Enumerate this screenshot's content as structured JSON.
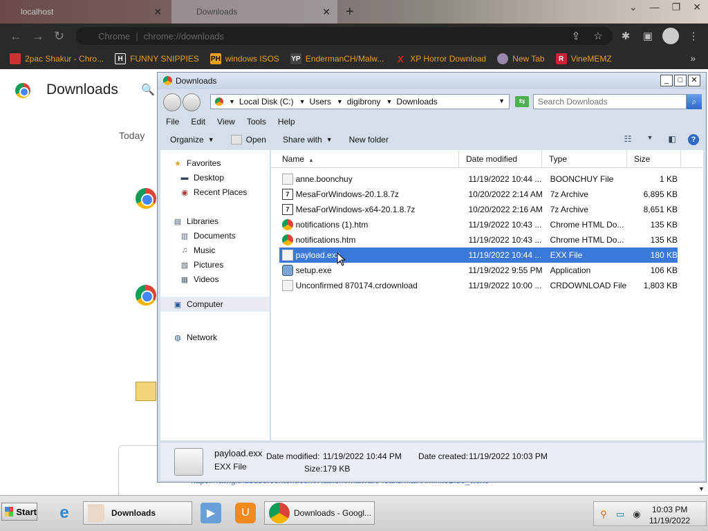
{
  "browser": {
    "tabs": [
      {
        "label": "localhost"
      },
      {
        "label": "Downloads"
      }
    ],
    "omnibox": {
      "prefix": "Chrome",
      "separator": "|",
      "url": "chrome://downloads"
    },
    "bookmarks": [
      {
        "label": "2pac Shakur - Chro...",
        "icon": "red-square-icon",
        "color": "#cc3333",
        "glyph": ""
      },
      {
        "label": "FUNNY SNIPPIES",
        "icon": "h-logo-icon",
        "color": "#333333",
        "glyph": "H"
      },
      {
        "label": "windows ISOS",
        "icon": "ph-logo-icon",
        "color": "#e8a020",
        "glyph": "PH"
      },
      {
        "label": "EndermanCH/Malw...",
        "icon": "yp-logo-icon",
        "color": "#444444",
        "glyph": "YP"
      },
      {
        "label": "XP Horror Download",
        "icon": "x-logo-icon",
        "color": "#2a2a2a",
        "glyph": "X"
      },
      {
        "label": "New Tab",
        "icon": "globe-icon",
        "color": "#9988aa",
        "glyph": ""
      },
      {
        "label": "VineMEMZ",
        "icon": "r-logo-icon",
        "color": "#cc2233",
        "glyph": "R"
      }
    ]
  },
  "downloads_page": {
    "title": "Downloads",
    "section": "Today",
    "url_fragment": "https://raw.githubusercontent.com/Hatkom/malware-leaks/main/InfiniteBlue_v.exe"
  },
  "explorer": {
    "title": "Downloads",
    "breadcrumb": [
      "Local Disk (C:)",
      "Users",
      "digibrony",
      "Downloads"
    ],
    "search_placeholder": "Search Downloads",
    "menu": [
      "File",
      "Edit",
      "View",
      "Tools",
      "Help"
    ],
    "commands": {
      "organize": "Organize",
      "open": "Open",
      "share": "Share with",
      "new_folder": "New folder"
    },
    "nav": {
      "favorites": "Favorites",
      "desktop": "Desktop",
      "recent": "Recent Places",
      "libraries": "Libraries",
      "documents": "Documents",
      "music": "Music",
      "pictures": "Pictures",
      "videos": "Videos",
      "computer": "Computer",
      "network": "Network"
    },
    "columns": {
      "name": "Name",
      "date": "Date modified",
      "type": "Type",
      "size": "Size"
    },
    "files": [
      {
        "name": "anne.boonchuy",
        "date": "11/19/2022 10:44 ...",
        "type": "BOONCHUY File",
        "size": "1 KB",
        "icon": "blank-file-icon"
      },
      {
        "name": "MesaForWindows-20.1.8.7z",
        "date": "10/20/2022 2:14 AM",
        "type": "7z Archive",
        "size": "6,895 KB",
        "icon": "7z-archive-icon"
      },
      {
        "name": "MesaForWindows-x64-20.1.8.7z",
        "date": "10/20/2022 2:16 AM",
        "type": "7z Archive",
        "size": "8,651 KB",
        "icon": "7z-archive-icon"
      },
      {
        "name": "notifications (1).htm",
        "date": "11/19/2022 10:43 ...",
        "type": "Chrome HTML Do...",
        "size": "135 KB",
        "icon": "chrome-icon"
      },
      {
        "name": "notifications.htm",
        "date": "11/19/2022 10:43 ...",
        "type": "Chrome HTML Do...",
        "size": "135 KB",
        "icon": "chrome-icon"
      },
      {
        "name": "payload.exx",
        "date": "11/19/2022 10:44 ...",
        "type": "EXX File",
        "size": "180 KB",
        "icon": "blank-file-icon",
        "selected": true
      },
      {
        "name": "setup.exe",
        "date": "11/19/2022 9:55 PM",
        "type": "Application",
        "size": "106 KB",
        "icon": "setup-icon"
      },
      {
        "name": "Unconfirmed 870174.crdownload",
        "date": "11/19/2022 10:00 ...",
        "type": "CRDOWNLOAD File",
        "size": "1,803 KB",
        "icon": "blank-file-icon"
      }
    ],
    "details": {
      "name": "payload.exx",
      "type": "EXX File",
      "modified_label": "Date modified:",
      "modified": "11/19/2022 10:44 PM",
      "created_label": "Date created:",
      "created": "11/19/2022 10:03 PM",
      "size_label": "Size:",
      "size": "179 KB"
    }
  },
  "taskbar": {
    "start": "Start",
    "explorer_task": "Downloads",
    "chrome_task": "Downloads - Googl...",
    "clock_time": "10:03 PM",
    "clock_date": "11/19/2022"
  },
  "colors": {
    "selection": "#3b79d9",
    "bookmark_text": "#e8a020",
    "chrome_dark": "#2a2a2a"
  }
}
